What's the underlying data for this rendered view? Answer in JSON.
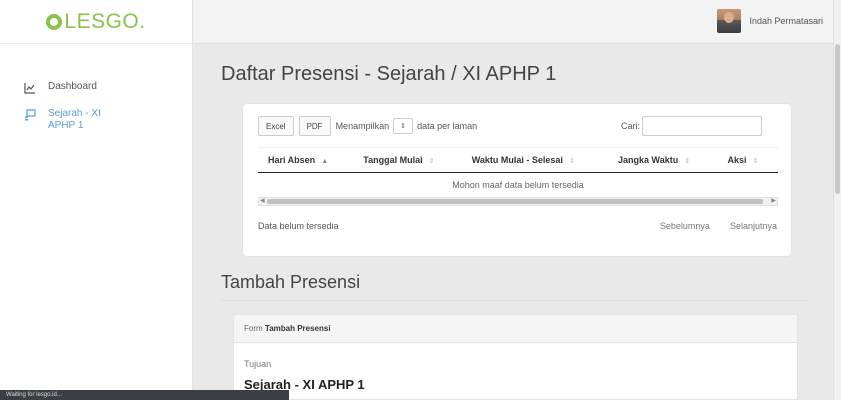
{
  "brand": {
    "logo": "LESGO."
  },
  "user": {
    "name": "Indah Permatasari"
  },
  "sidebar": {
    "items": [
      {
        "label": "Dashboard"
      },
      {
        "label": "Sejarah - XI APHP 1"
      }
    ]
  },
  "page": {
    "title": "Daftar Presensi - Sejarah / XI APHP 1"
  },
  "table": {
    "buttons": {
      "excel": "Excel",
      "pdf": "PDF"
    },
    "length_prefix": "Menampilkan",
    "length_value": "",
    "length_suffix": "data per laman",
    "search_label": "Cari:",
    "search_value": "",
    "columns": [
      "Hari Absen",
      "Tanggal Mulai",
      "Waktu Mulai - Selesai",
      "Jangka Waktu",
      "Aksi"
    ],
    "empty_message": "Mohon maaf data belum tersedia",
    "info": "Data belum tersedia",
    "prev": "Sebelumnya",
    "next": "Selanjutnya"
  },
  "section": {
    "title": "Tambah Presensi"
  },
  "form": {
    "header_prefix": "Form",
    "header_bold": "Tambah Presensi",
    "field_label": "Tujuan",
    "field_value": "Sejarah - XI APHP 1"
  },
  "statusbar": {
    "text": "Waiting for lesgo.id..."
  },
  "colors": {
    "brand_green": "#8bc34a",
    "active_blue": "#5b9bd5"
  },
  "icons": [
    "logo-mark-icon",
    "chart-icon",
    "chalkboard-icon",
    "sort-icon"
  ]
}
